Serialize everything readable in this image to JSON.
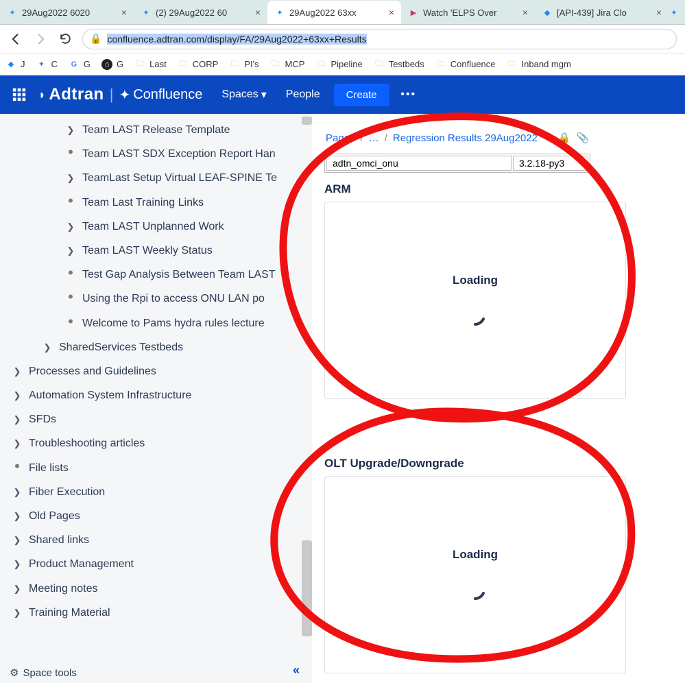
{
  "browser": {
    "tabs": [
      {
        "title": "29Aug2022 6020",
        "icon": "confluence",
        "active": false
      },
      {
        "title": "(2) 29Aug2022 60",
        "icon": "confluence",
        "active": false
      },
      {
        "title": "29Aug2022 63xx",
        "icon": "confluence",
        "active": true
      },
      {
        "title": "Watch 'ELPS Over",
        "icon": "video",
        "active": false
      },
      {
        "title": "[API-439] Jira Clo",
        "icon": "jira",
        "active": false
      }
    ],
    "url": "confluence.adtran.com/display/FA/29Aug2022+63xx+Results",
    "bookmarks": [
      {
        "label": "J",
        "icon": "jira"
      },
      {
        "label": "C",
        "icon": "confluence"
      },
      {
        "label": "G",
        "icon": "google"
      },
      {
        "label": "G",
        "icon": "github"
      },
      {
        "label": "Last",
        "icon": "folder"
      },
      {
        "label": "CORP",
        "icon": "folder"
      },
      {
        "label": "PI's",
        "icon": "folder"
      },
      {
        "label": "MCP",
        "icon": "folder"
      },
      {
        "label": "Pipeline",
        "icon": "folder"
      },
      {
        "label": "Testbeds",
        "icon": "folder"
      },
      {
        "label": "Confluence",
        "icon": "folder"
      },
      {
        "label": "Inband mgm",
        "icon": "folder"
      }
    ]
  },
  "header": {
    "logo": "Adtran",
    "product": "Confluence",
    "nav_spaces": "Spaces",
    "nav_people": "People",
    "create_label": "Create",
    "more_label": "•••"
  },
  "sidebar": {
    "items": [
      {
        "indent": 2,
        "icon": "chev",
        "label": "Team LAST Release Template"
      },
      {
        "indent": 2,
        "icon": "dot",
        "label": "Team LAST SDX Exception Report Han"
      },
      {
        "indent": 2,
        "icon": "chev",
        "label": "TeamLast Setup Virtual LEAF-SPINE Te"
      },
      {
        "indent": 2,
        "icon": "dot",
        "label": "Team Last Training Links"
      },
      {
        "indent": 2,
        "icon": "chev",
        "label": "Team LAST Unplanned Work"
      },
      {
        "indent": 2,
        "icon": "chev",
        "label": "Team LAST Weekly Status"
      },
      {
        "indent": 2,
        "icon": "dot",
        "label": "Test Gap Analysis Between Team LAST"
      },
      {
        "indent": 2,
        "icon": "dot",
        "label": "Using the Rpi to access ONU LAN po"
      },
      {
        "indent": 2,
        "icon": "dot",
        "label": "Welcome to Pams hydra rules lecture"
      },
      {
        "indent": 1,
        "icon": "chev",
        "label": "SharedServices Testbeds"
      },
      {
        "indent": 0,
        "icon": "chev",
        "label": "Processes and Guidelines"
      },
      {
        "indent": 0,
        "icon": "chev",
        "label": "Automation System Infrastructure"
      },
      {
        "indent": 0,
        "icon": "chev",
        "label": "SFDs"
      },
      {
        "indent": 0,
        "icon": "chev",
        "label": "Troubleshooting articles"
      },
      {
        "indent": 0,
        "icon": "dot",
        "label": "File lists"
      },
      {
        "indent": 0,
        "icon": "chev",
        "label": "Fiber Execution"
      },
      {
        "indent": 0,
        "icon": "chev",
        "label": "Old Pages"
      },
      {
        "indent": 0,
        "icon": "chev",
        "label": "Shared links"
      },
      {
        "indent": 0,
        "icon": "chev",
        "label": "Product Management"
      },
      {
        "indent": 0,
        "icon": "chev",
        "label": "Meeting notes"
      },
      {
        "indent": 0,
        "icon": "chev",
        "label": "Training Material"
      }
    ],
    "space_tools_label": "Space tools"
  },
  "main": {
    "breadcrumb": {
      "root": "Pages",
      "ellipsis": "…",
      "current": "Regression Results 29Aug2022"
    },
    "table_row": {
      "c1": "adtn_omci_onu",
      "c2": "3.2.18-py3"
    },
    "section1_heading": "ARM",
    "section2_heading": "OLT Upgrade/Downgrade",
    "loading_label": "Loading"
  }
}
